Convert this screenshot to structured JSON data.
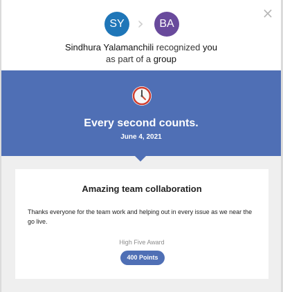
{
  "header": {
    "close_icon": "close-icon",
    "avatars": {
      "sender_initials": "SY",
      "recipient_initials": "BA"
    },
    "recognition": {
      "sender_name": "Sindhura Yalamanchili",
      "recognized_text": "recognized",
      "recipient_word": "you",
      "line2_prefix": "as part of a",
      "line2_group": "group"
    },
    "chevron_icon": "chevron-right-icon"
  },
  "banner": {
    "icon": "clock-icon",
    "title": "Every second counts.",
    "date": "June 4, 2021"
  },
  "card": {
    "title": "Amazing team collaboration",
    "message": "Thanks everyone for the team work and helping out in every issue as we near the go live.",
    "award_name": "High Five Award",
    "points_label": "400 Points"
  },
  "colors": {
    "background": "#dcdcdc",
    "modal_bg": "#efefef",
    "banner_blue": "#4f6fb5",
    "sender_avatar": "#1f76b8",
    "recipient_avatar": "#694a9c"
  }
}
